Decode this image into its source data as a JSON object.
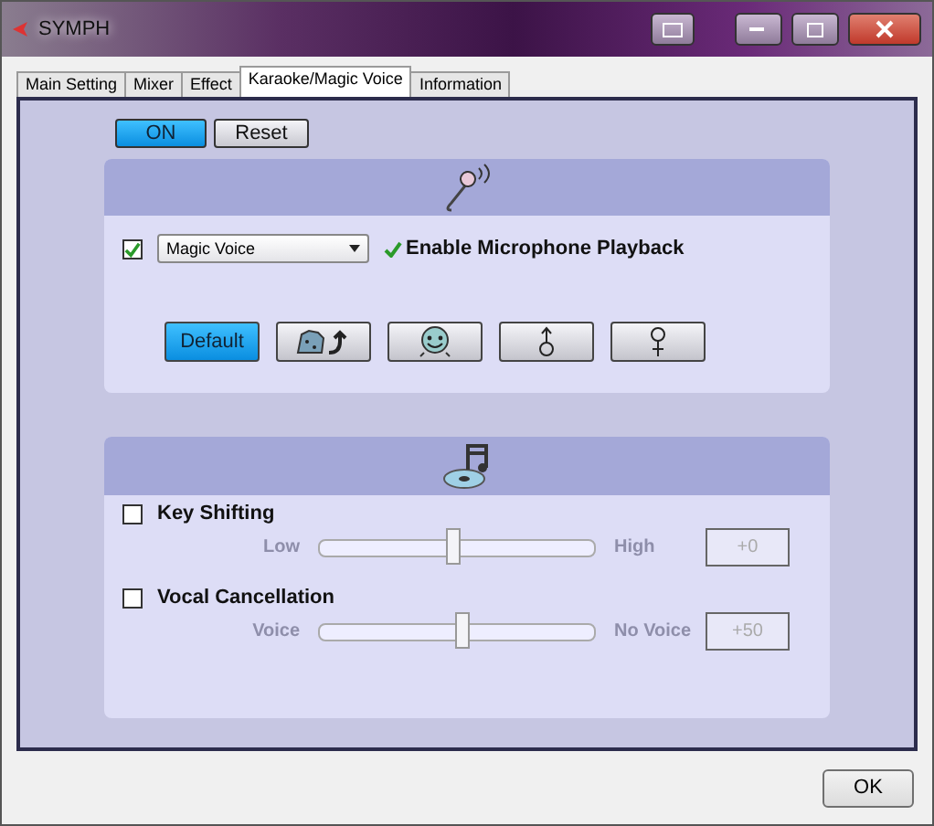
{
  "window": {
    "title": "SYMPH"
  },
  "tabs": [
    {
      "label": "Main Setting",
      "selected": false
    },
    {
      "label": "Mixer",
      "selected": false
    },
    {
      "label": "Effect",
      "selected": false
    },
    {
      "label": "Karaoke/Magic Voice",
      "selected": true
    },
    {
      "label": "Information",
      "selected": false
    }
  ],
  "power": {
    "label": "ON",
    "on": true
  },
  "reset": {
    "label": "Reset"
  },
  "magic_voice": {
    "checked": true,
    "dropdown": "Magic Voice",
    "playback": {
      "label": "Enable Microphone Playback",
      "checked": true
    }
  },
  "voice_presets": [
    {
      "kind": "text",
      "label": "Default",
      "selected": true
    },
    {
      "kind": "monster",
      "selected": false
    },
    {
      "kind": "face",
      "selected": false
    },
    {
      "kind": "male",
      "selected": false
    },
    {
      "kind": "female",
      "selected": false
    }
  ],
  "sliders": [
    {
      "label": "Key Shifting",
      "checked": false,
      "min_label": "Low",
      "max_label": "High",
      "level": 0.49,
      "value": "+0"
    },
    {
      "label": "Vocal Cancellation",
      "checked": false,
      "min_label": "Voice",
      "max_label": "No Voice",
      "level": 0.52,
      "value": "+50"
    }
  ],
  "ok_button": "OK"
}
